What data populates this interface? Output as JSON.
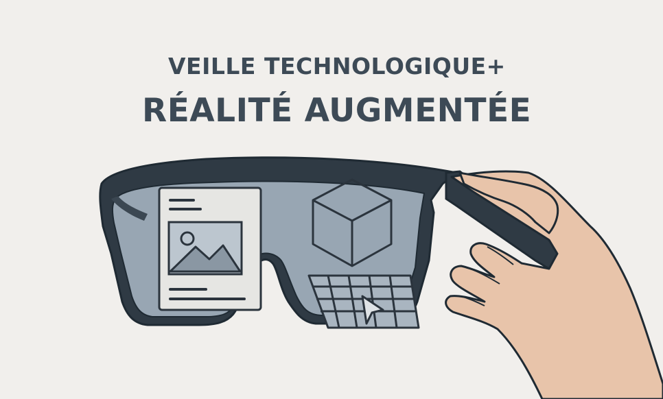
{
  "heading": {
    "line1": "VEILLE TECHNOLOGIQUE+",
    "line2": "RÉALITÉ AUGMENTÉE"
  },
  "icons": [
    "ar-glasses-icon",
    "document-image-card-icon",
    "cube-wireframe-icon",
    "grid-keyboard-icon",
    "cursor-pointer-icon",
    "hand-icon"
  ],
  "colors": {
    "background": "#f1efec",
    "heading_text": "#3d4a56",
    "frame": "#2f3a44",
    "lens": "#98a6b3",
    "skin": "#e8c4aa",
    "outline": "#1f2a33"
  }
}
